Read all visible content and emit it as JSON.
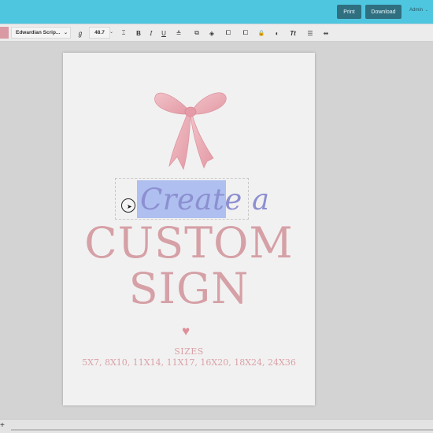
{
  "header": {
    "print_label": "Print",
    "download_label": "Download",
    "user_label": "Admin",
    "chevron": "⌄",
    "accent_color": "#4fc6e0"
  },
  "toolbar": {
    "color_swatch": "#d99aa3",
    "font_name": "Edwardian Scrip...",
    "font_chevron": "⌄",
    "font_size": "48.7",
    "size_chevron": "⌄",
    "icons": {
      "font_style": "ℊ",
      "text_height": "⌶",
      "bold": "B",
      "italic": "I",
      "underline": "U",
      "align": "≙",
      "add_element": "⧉",
      "layers": "◈",
      "duplicate": "⧠",
      "lock": "🔒",
      "color": "◐",
      "text_case": "Tt",
      "line_spacing": "☰",
      "letter_spacing": "⇹"
    }
  },
  "document": {
    "script_line": "Create a",
    "line_custom": "CUSTOM",
    "line_sign": "SIGN",
    "heart": "♥",
    "sizes_label": "SIZES",
    "sizes_list": "5X7, 8X10, 11X14, 11X17, 16X20, 18X24, 24X36",
    "cursor_arrow": "➤",
    "text_color": "#d5a0a6",
    "highlight_color": "#aebff0"
  },
  "bottom": {
    "add_label": "+"
  }
}
